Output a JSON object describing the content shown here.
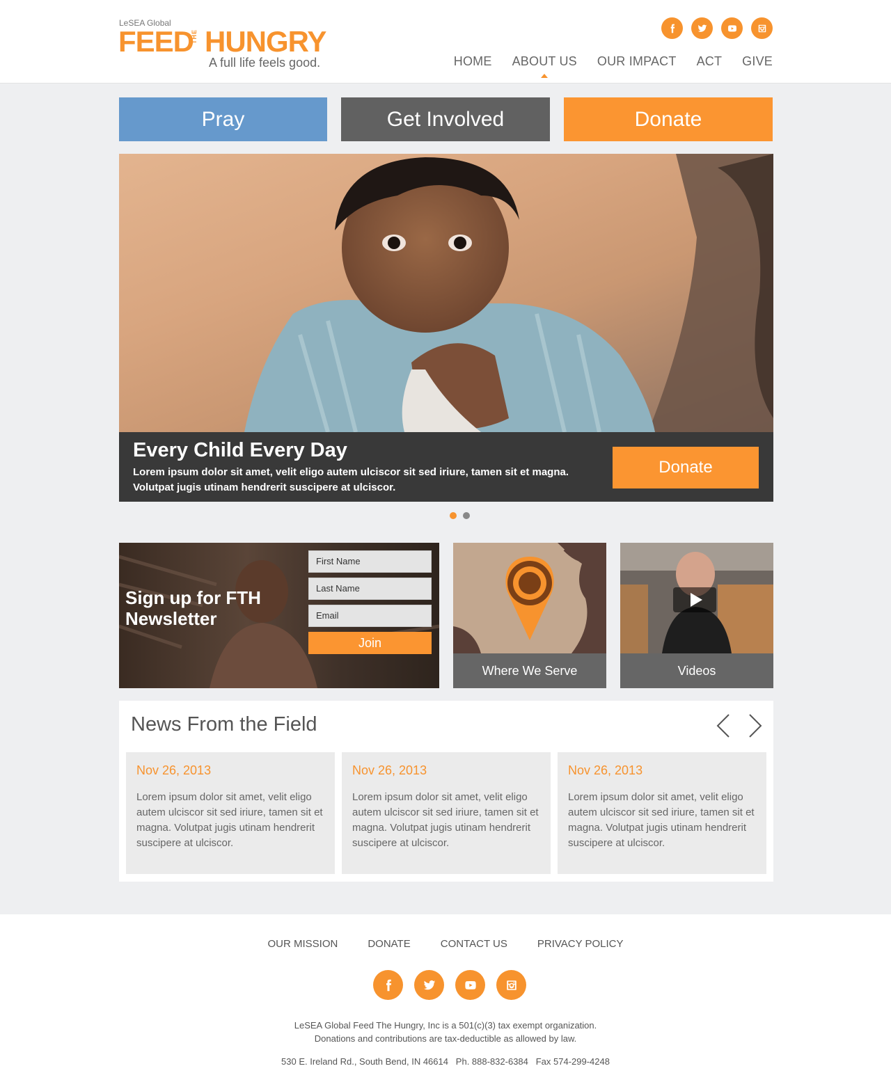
{
  "brand": {
    "small": "LeSEA Global",
    "feed": "FEED",
    "the": "THE",
    "hungry": "HUNGRY",
    "tagline": "A full life feels good."
  },
  "social": [
    "facebook-icon",
    "twitter-icon",
    "youtube-icon",
    "instagram-icon"
  ],
  "nav": {
    "items": [
      {
        "label": "HOME"
      },
      {
        "label": "ABOUT US"
      },
      {
        "label": "OUR IMPACT"
      },
      {
        "label": "ACT"
      },
      {
        "label": "GIVE"
      }
    ],
    "active": "ABOUT US"
  },
  "actions": {
    "pray": "Pray",
    "involved": "Get Involved",
    "donate": "Donate"
  },
  "hero": {
    "title": "Every Child Every Day",
    "text": "Lorem ipsum dolor sit amet, velit eligo autem ulciscor sit sed iriure, tamen sit et magna. Volutpat jugis utinam hendrerit suscipere at ulciscor.",
    "button": "Donate",
    "slides": 2,
    "active_slide": 1
  },
  "newsletter": {
    "title": "Sign up for FTH Newsletter",
    "first_name": "First Name",
    "last_name": "Last Name",
    "email": "Email",
    "join": "Join"
  },
  "tiles": {
    "serve": "Where We Serve",
    "videos": "Videos"
  },
  "news": {
    "title": "News From the Field",
    "cards": [
      {
        "date": "Nov 26, 2013",
        "text": "Lorem ipsum dolor sit amet, velit eligo autem ulciscor sit sed iriure, tamen sit et magna. Volutpat jugis utinam hendrerit suscipere at ulciscor."
      },
      {
        "date": "Nov 26, 2013",
        "text": "Lorem ipsum dolor sit amet, velit eligo autem ulciscor sit sed iriure, tamen sit et magna. Volutpat jugis utinam hendrerit suscipere at ulciscor."
      },
      {
        "date": "Nov 26, 2013",
        "text": "Lorem ipsum dolor sit amet, velit eligo autem ulciscor sit sed iriure, tamen sit et magna. Volutpat jugis utinam hendrerit suscipere at ulciscor."
      }
    ]
  },
  "footer": {
    "links": [
      "OUR MISSION",
      "DONATE",
      "CONTACT US",
      "PRIVACY POLICY"
    ],
    "line1": "LeSEA Global Feed The Hungry, Inc is a 501(c)(3) tax exempt organization.",
    "line2": "Donations and contributions are tax-deductible as allowed by law.",
    "address": "530 E. Ireland Rd., South Bend, IN 46614   Ph. 888-832-6384   Fax 574-299-4248"
  },
  "colors": {
    "accent": "#f7932e",
    "pray": "#6699cc",
    "involved": "#616161",
    "dark": "#393939"
  }
}
